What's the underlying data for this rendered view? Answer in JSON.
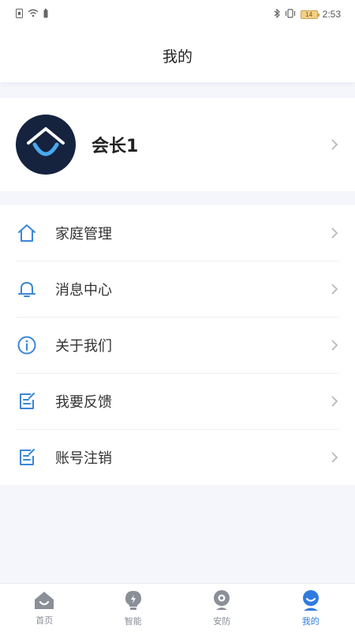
{
  "status_bar": {
    "time": "2:53",
    "battery_level": "14"
  },
  "header": {
    "title": "我的"
  },
  "profile": {
    "name": "会长1"
  },
  "menu": {
    "items": [
      {
        "label": "家庭管理",
        "icon": "house-icon"
      },
      {
        "label": "消息中心",
        "icon": "bell-icon"
      },
      {
        "label": "关于我们",
        "icon": "info-icon"
      },
      {
        "label": "我要反馈",
        "icon": "feedback-icon"
      },
      {
        "label": "账号注销",
        "icon": "account-cancel-icon"
      }
    ]
  },
  "tabbar": {
    "tabs": [
      {
        "label": "首页",
        "icon": "home-icon",
        "active": false
      },
      {
        "label": "智能",
        "icon": "bulb-icon",
        "active": false
      },
      {
        "label": "安防",
        "icon": "camera-icon",
        "active": false
      },
      {
        "label": "我的",
        "icon": "profile-icon",
        "active": true
      }
    ]
  },
  "colors": {
    "accent": "#2f7be0",
    "icon_blue": "#3b86d8",
    "avatar_bg": "#15233f",
    "page_bg": "#f4f6fb"
  }
}
